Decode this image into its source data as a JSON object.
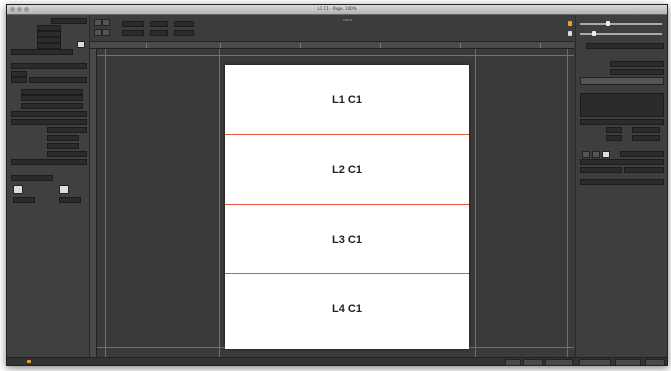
{
  "window": {
    "title": "L1 C1 - Page, 100%"
  },
  "canvas": {
    "rows": [
      {
        "label": "L1 C1"
      },
      {
        "label": "L2 C1"
      },
      {
        "label": "L3 C1"
      },
      {
        "label": "L4 C1"
      }
    ],
    "separator_color": "#e2583e"
  },
  "colors": {
    "accent": "#f0a020",
    "background": "#3a3a3a"
  },
  "toolbar": {
    "zoom": "100 %"
  }
}
